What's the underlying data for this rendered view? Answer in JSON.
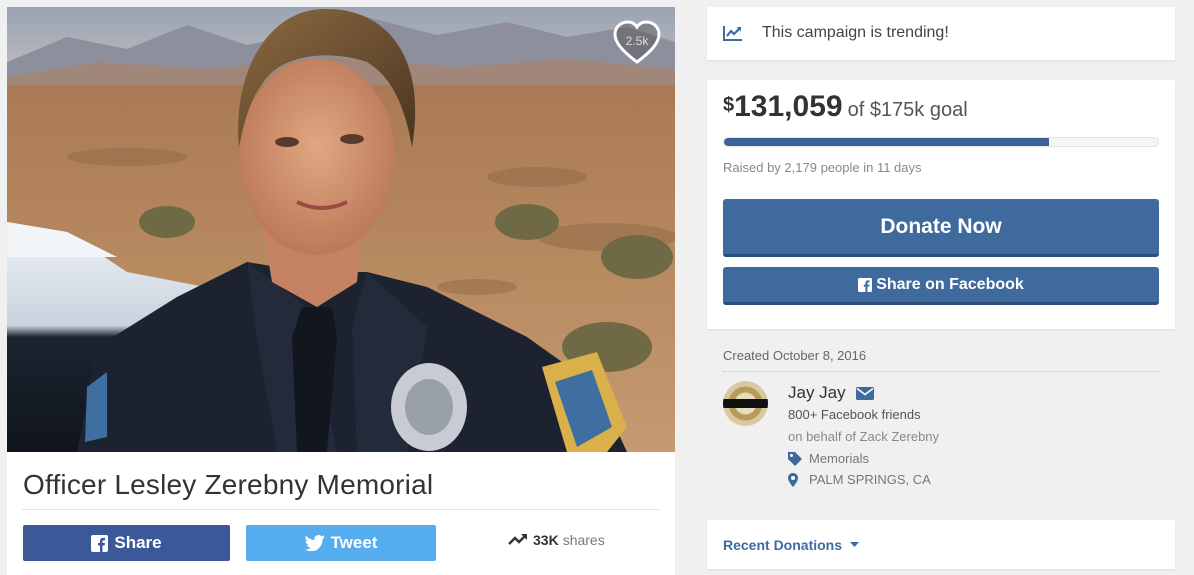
{
  "campaign": {
    "title": "Officer Lesley Zerebny Memorial",
    "hearts": "2.5k"
  },
  "social": {
    "share_label": "Share",
    "tweet_label": "Tweet",
    "shares_count": "33K",
    "shares_label": "shares"
  },
  "trending": {
    "text": "This campaign is trending!",
    "icon": "trending-chart-icon"
  },
  "donation": {
    "currency": "$",
    "amount": "131,059",
    "goal_text": "of $175k goal",
    "progress_fraction": 0.749,
    "raised_text": "Raised by 2,179 people in 11 days",
    "donate_label": "Donate Now",
    "facebook_label": "Share on Facebook"
  },
  "organizer": {
    "created": "Created October 8, 2016",
    "name": "Jay Jay",
    "friends": "800+ Facebook friends",
    "behalf": "on behalf of Zack Zerebny",
    "category": "Memorials",
    "location": "PALM SPRINGS, CA"
  },
  "recent": {
    "label": "Recent Donations"
  },
  "colors": {
    "facebook": "#3b5998",
    "twitter": "#55acee",
    "primary": "#3f6a9e",
    "background": "#f0f0f0"
  }
}
